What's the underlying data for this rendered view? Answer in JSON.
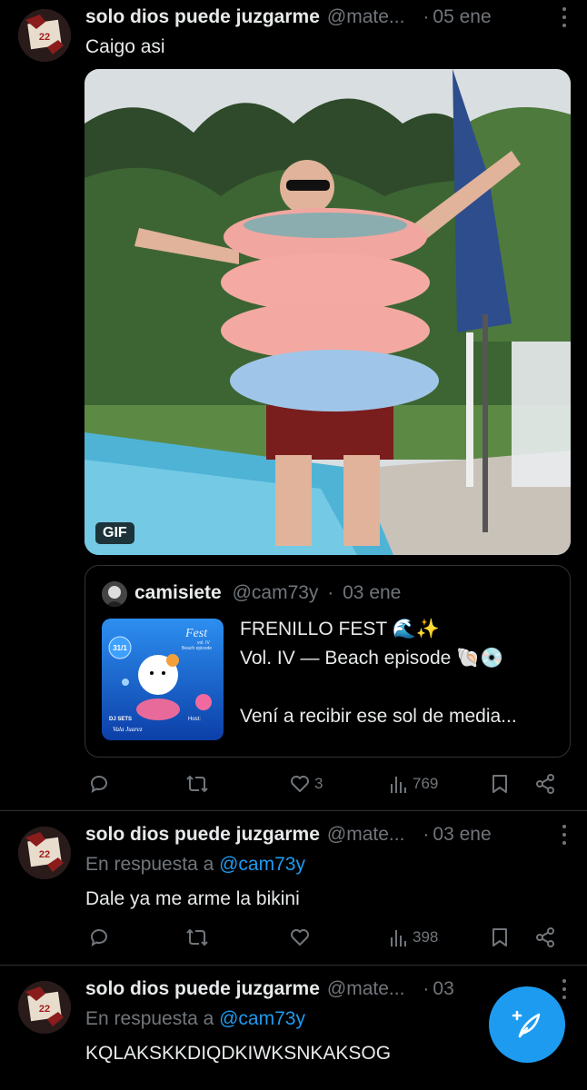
{
  "tweets": [
    {
      "name": "solo dios puede juzgarme",
      "handle": "@mate...",
      "sep": "·",
      "date": "05 ene",
      "text": "Caigo asi",
      "gif_badge": "GIF",
      "quote": {
        "name": "camisiete",
        "handle": "@cam73y",
        "sep": "·",
        "date": "03 ene",
        "line1": "FRENILLO FEST 🌊✨",
        "line2": "Vol. IV — Beach episode 🐚💿",
        "line3": "Vení a recibir ese sol de media...",
        "thumb_texts": [
          "Fest",
          "vol. IV",
          "Beach episode",
          "31/1",
          "DJ SETS",
          "Vala Juarez",
          "Host:"
        ]
      },
      "stats": {
        "replies": "",
        "retweets": "",
        "likes": "3",
        "views": "769"
      }
    },
    {
      "name": "solo dios puede juzgarme",
      "handle": "@mate...",
      "sep": "·",
      "date": "03 ene",
      "reply_prefix": "En respuesta a",
      "reply_mention": "@cam73y",
      "text": "Dale ya me arme la bikini",
      "stats": {
        "replies": "",
        "retweets": "",
        "likes": "",
        "views": "398"
      }
    },
    {
      "name": "solo dios puede juzgarme",
      "handle": "@mate...",
      "sep": "·",
      "date": "03",
      "reply_prefix": "En respuesta a",
      "reply_mention": "@cam73y",
      "text": "KQLAKSKKDIQDKIWKSNKAKSOG"
    }
  ],
  "colors": {
    "accent": "#1d9bf0",
    "muted": "#71767b",
    "text": "#e7e9ea",
    "divider": "#2f3336"
  },
  "icons": [
    "reply-icon",
    "retweet-icon",
    "like-icon",
    "views-icon",
    "bookmark-icon",
    "share-icon",
    "more-icon",
    "compose-icon"
  ]
}
